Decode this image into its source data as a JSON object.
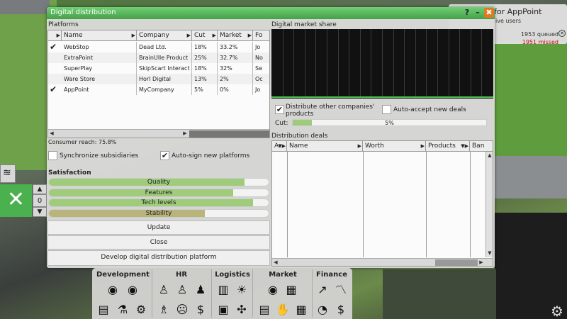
{
  "window": {
    "title": "Digital distribution",
    "help": "?",
    "minimize": "–",
    "close": "✖"
  },
  "notification": {
    "title": "for AppPoint",
    "subtitle": "ive users",
    "queued": "1953 queued",
    "missed": "1951 missed",
    "missed_color": "#c01010"
  },
  "platforms": {
    "label": "Platforms",
    "columns": [
      "Name",
      "Company",
      "Cut",
      "Market",
      "Fo"
    ],
    "rows": [
      {
        "checked": true,
        "name": "WebStop",
        "company": "Dead Ltd.",
        "cut": "18%",
        "market": "33.2%",
        "fo": "Jo"
      },
      {
        "checked": false,
        "name": "ExtraPoint",
        "company": "BrainUlle Product",
        "cut": "25%",
        "market": "32.7%",
        "fo": "No"
      },
      {
        "checked": false,
        "name": "SuperPlay",
        "company": "SkipScart Interact",
        "cut": "18%",
        "market": "32%",
        "fo": "Se"
      },
      {
        "checked": false,
        "name": "Ware Store",
        "company": "Horl Digital",
        "cut": "13%",
        "market": "2%",
        "fo": "Oc"
      },
      {
        "checked": true,
        "name": "AppPoint",
        "company": "MyCompany",
        "cut": "5%",
        "market": "0%",
        "fo": "Jo"
      }
    ]
  },
  "consumer_reach": "Consumer reach: 75.8%",
  "sync_subsidiaries": {
    "label": "Synchronize subsidiaries",
    "checked": false
  },
  "auto_sign": {
    "label": "Auto-sign new platforms",
    "checked": true
  },
  "satisfaction": {
    "label": "Satisfaction",
    "bars": [
      {
        "label": "Quality",
        "level": 0.89,
        "color": "#9fcc7a"
      },
      {
        "label": "Features",
        "level": 0.84,
        "color": "#9fcc7a"
      },
      {
        "label": "Tech levels",
        "level": 0.93,
        "color": "#9fcc7a"
      },
      {
        "label": "Stability",
        "level": 0.71,
        "color": "#b8b47a"
      }
    ]
  },
  "buttons": {
    "update": "Update",
    "close": "Close",
    "develop": "Develop digital distribution platform"
  },
  "market_share": {
    "label": "Digital market share"
  },
  "distribute_other": {
    "label": "Distribute other companies' products",
    "checked": true
  },
  "auto_accept": {
    "label": "Auto-accept new deals",
    "checked": false
  },
  "cut": {
    "label": "Cut:",
    "value": "5%",
    "level": 0.1
  },
  "deals": {
    "label": "Distribution deals",
    "columns": [
      "A",
      "Name",
      "Worth",
      "Products",
      "Ban"
    ]
  },
  "side": {
    "counter": "0"
  },
  "bottom": {
    "categories": [
      "Development",
      "HR",
      "Logistics",
      "Market",
      "Finance"
    ]
  },
  "colors": {
    "accent": "#4bb04e",
    "title_green": "#5cb85f",
    "close_orange": "#e07a20"
  }
}
